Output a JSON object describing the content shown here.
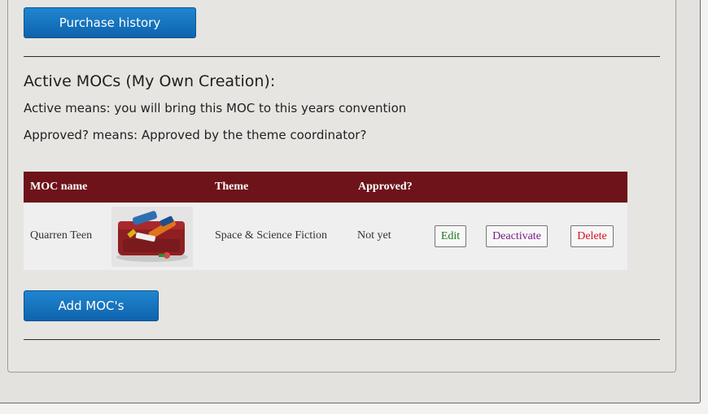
{
  "buttons": {
    "purchase_history": "Purchase history",
    "add_mocs": "Add MOC's"
  },
  "section": {
    "title": "Active MOCs (My Own Creation):",
    "active_note": "Active means: you will bring this MOC to this years convention",
    "approved_note": "Approved? means: Approved by the theme coordinator?"
  },
  "table": {
    "headers": [
      "MOC name",
      "Theme",
      "Approved?"
    ],
    "rows": [
      {
        "name": "Quarren Teen",
        "theme": "Space & Science Fiction",
        "approved": "Not yet",
        "edit": "Edit",
        "deactivate": "Deactivate",
        "delete": "Delete"
      }
    ]
  },
  "colors": {
    "header_bg": "#6d1319",
    "edit": "#1f7a1f",
    "deactivate": "#7a1f8a",
    "delete": "#d2141e",
    "button_blue": "#1473c0"
  }
}
